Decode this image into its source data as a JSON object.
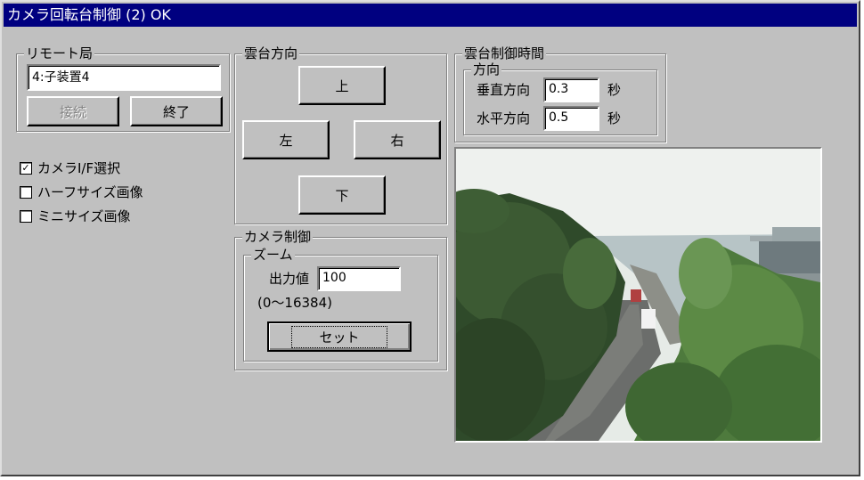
{
  "window": {
    "title": "カメラ回転台制御 (2) OK"
  },
  "remote": {
    "legend": "リモート局",
    "station_value": "4:子装置4",
    "connect_label": "接続",
    "exit_label": "終了"
  },
  "options": {
    "camera_if": {
      "label": "カメラI/F選択",
      "checked": "✓"
    },
    "half_size": {
      "label": "ハーフサイズ画像",
      "checked": ""
    },
    "mini_size": {
      "label": "ミニサイズ画像",
      "checked": ""
    }
  },
  "pan_direction": {
    "legend": "雲台方向",
    "up": "上",
    "left": "左",
    "right": "右",
    "down": "下"
  },
  "camera_control": {
    "legend": "カメラ制御",
    "zoom_legend": "ズーム",
    "output_label": "出力値",
    "output_value": "100",
    "range_text": "(0〜16384)",
    "set_label": "セット"
  },
  "pan_time": {
    "legend": "雲台制御時間",
    "direction_legend": "方向",
    "vertical_label": "垂直方向",
    "vertical_value": "0.3",
    "horizontal_label": "水平方向",
    "horizontal_value": "0.5",
    "unit": "秒"
  },
  "colors": {
    "title_bar": "#000080",
    "face": "#c0c0c0"
  }
}
